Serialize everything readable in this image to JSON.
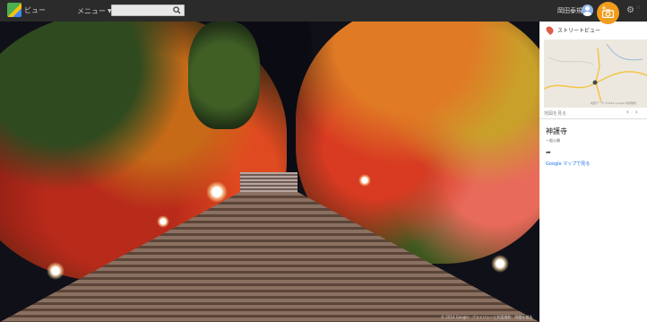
{
  "topbar": {
    "brand_label": "ビュー",
    "menu_label": "メニュー",
    "search": {
      "value": "",
      "placeholder": ""
    },
    "user_name": "岡田泰規"
  },
  "panel": {
    "title": "ストリートビュー",
    "map_caption": "地図データ ©2014 Google  利用規約",
    "view_map_label": "地図を見る",
    "place_name": "神護寺",
    "place_subtitle": "一般公開",
    "open_in_maps": "Google マップで見る"
  },
  "pano": {
    "copyright": "© 2014 Google · プライバシーと利用規約 · 問題を報告"
  },
  "colors": {
    "topbar": "#2b2b2b",
    "accent_orange": "#f29c1d",
    "link_blue": "#1a73e8"
  },
  "icons": [
    "logo-icon",
    "chevron-down-icon",
    "search-icon",
    "avatar-icon",
    "camera-icon",
    "gear-icon",
    "map-pin-icon",
    "more-vert-icon",
    "close-icon",
    "chevron-left-icon",
    "chevron-right-icon",
    "share-icon"
  ]
}
